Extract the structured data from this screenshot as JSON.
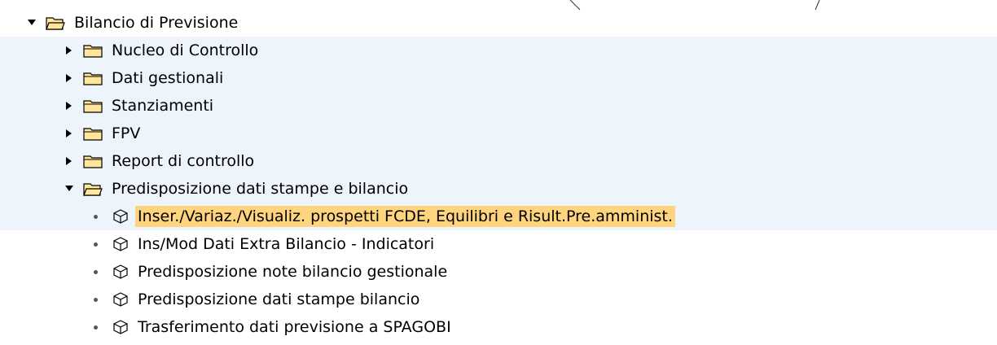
{
  "tree": {
    "root": {
      "label": "Bilancio di Previsione",
      "expanded": true,
      "icon": "folder-open-icon"
    },
    "folders": [
      {
        "label": "Nucleo di Controllo",
        "expanded": false,
        "icon": "folder-icon"
      },
      {
        "label": "Dati gestionali",
        "expanded": false,
        "icon": "folder-icon"
      },
      {
        "label": "Stanziamenti",
        "expanded": false,
        "icon": "folder-icon"
      },
      {
        "label": "FPV",
        "expanded": false,
        "icon": "folder-icon"
      },
      {
        "label": "Report di controllo",
        "expanded": false,
        "icon": "folder-icon"
      },
      {
        "label": "Predisposizione dati stampe e bilancio",
        "expanded": true,
        "icon": "folder-open-icon"
      }
    ],
    "transactions": [
      {
        "label": "Inser./Variaz./Visualiz. prospetti FCDE, Equilibri e Risult.Pre.amminist.",
        "selected": true,
        "icon": "transaction-cube-icon"
      },
      {
        "label": "Ins/Mod Dati Extra Bilancio - Indicatori",
        "selected": false,
        "icon": "transaction-cube-icon"
      },
      {
        "label": "Predisposizione note bilancio gestionale",
        "selected": false,
        "icon": "transaction-cube-icon"
      },
      {
        "label": "Predisposizione dati stampe bilancio",
        "selected": false,
        "icon": "transaction-cube-icon"
      },
      {
        "label": "Trasferimento dati previsione a SPAGOBI",
        "selected": false,
        "icon": "transaction-cube-icon"
      }
    ]
  },
  "colors": {
    "selection": "#ffd47e",
    "alt_row": "#eef4fb",
    "folder_fill": "#ffe69a"
  }
}
